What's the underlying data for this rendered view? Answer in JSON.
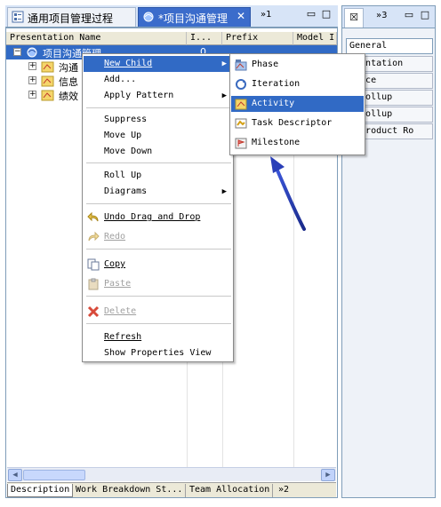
{
  "tabs": [
    {
      "label": "通用项目管理过程",
      "active": false
    },
    {
      "label": "*项目沟通管理",
      "active": true
    }
  ],
  "tab_overflow": "»1",
  "columns": [
    "Presentation Name",
    "I...",
    "Prefix",
    "Model I"
  ],
  "tree": {
    "root": {
      "label": "项目沟通管理",
      "index": "0"
    },
    "children": [
      {
        "label": "沟通"
      },
      {
        "label": "信息"
      },
      {
        "label": "绩效"
      }
    ]
  },
  "bottom_tabs": [
    "Description",
    "Work Breakdown St...",
    "Team Allocation",
    "»2"
  ],
  "right_panel": {
    "overflow": "»3",
    "rows": [
      "General",
      "umentation",
      "dance",
      "k Rollup",
      "n Rollup",
      "k Product Ro"
    ]
  },
  "context_menu": {
    "new_child": "New Child",
    "add": "Add...",
    "apply_pattern": "Apply Pattern",
    "suppress": "Suppress",
    "move_up": "Move Up",
    "move_down": "Move Down",
    "roll_up": "Roll Up",
    "diagrams": "Diagrams",
    "undo": "Undo Drag and Drop",
    "redo": "Redo",
    "copy": "Copy",
    "paste": "Paste",
    "delete": "Delete",
    "refresh": "Refresh",
    "show_properties": "Show Properties View"
  },
  "submenu": [
    "Phase",
    "Iteration",
    "Activity",
    "Task Descriptor",
    "Milestone"
  ],
  "colors": {
    "selection": "#316ac5",
    "tab_active": "#3b6ccb",
    "arrow": "#2a3fb8"
  }
}
